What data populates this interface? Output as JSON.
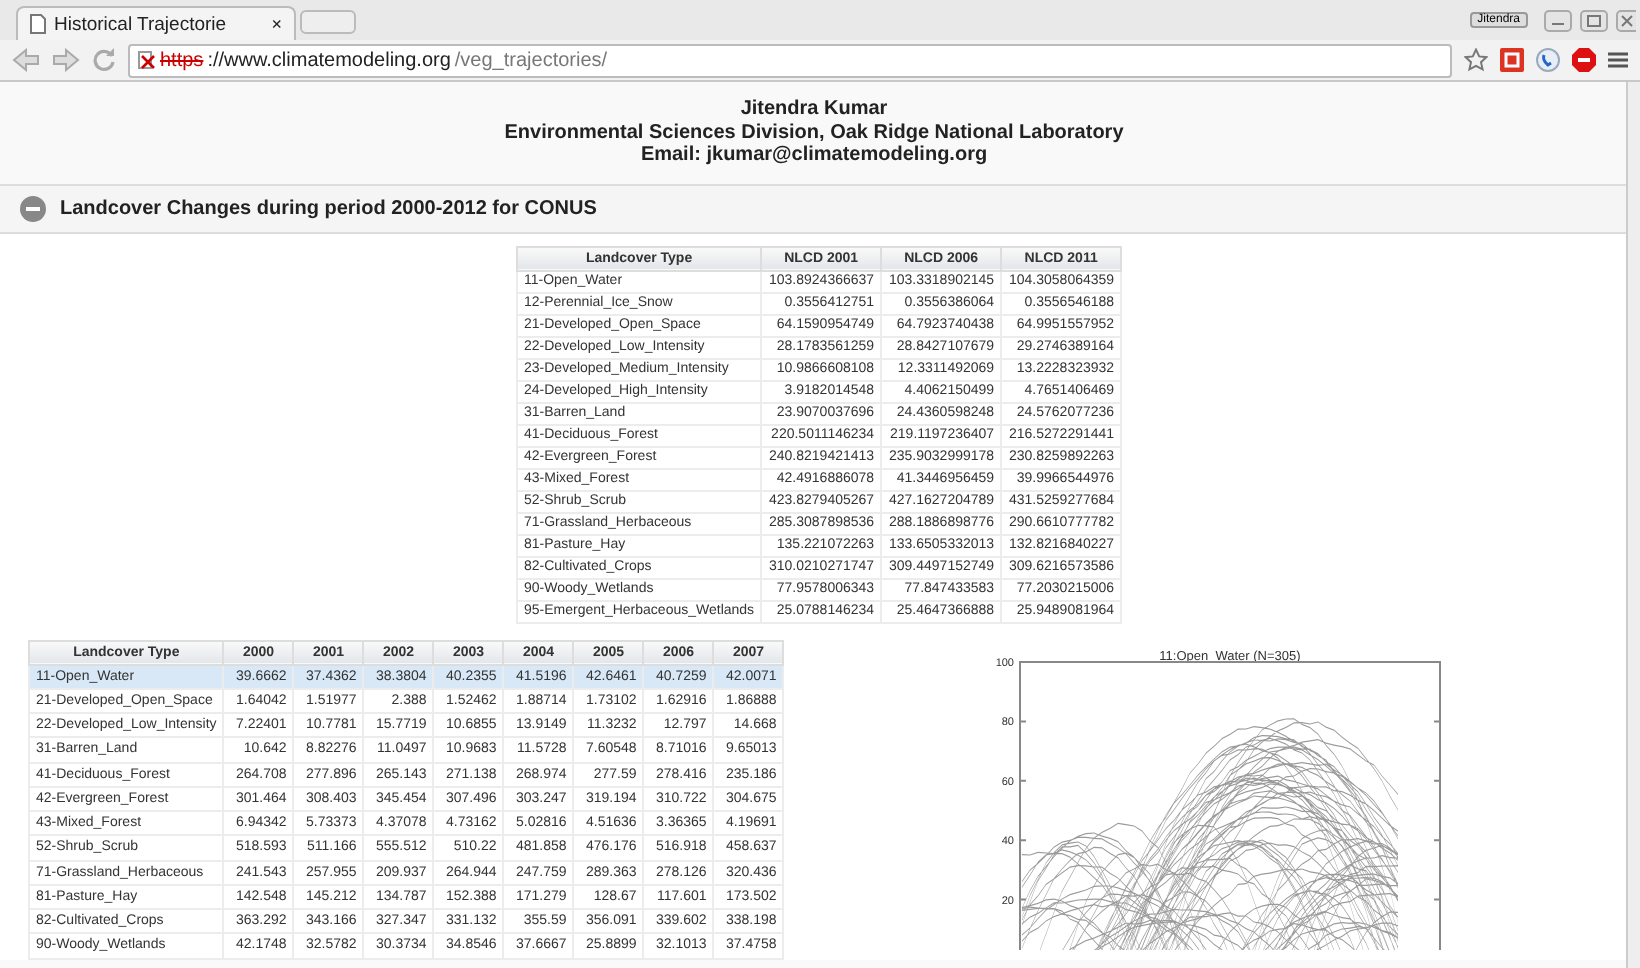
{
  "browser": {
    "tab_title": "Historical Trajectorie",
    "tab_close": "×",
    "profile": "Jitendra",
    "url_scheme": "https",
    "url_host": "://www.climatemodeling.org",
    "url_path": "/veg_trajectories/"
  },
  "author": {
    "name": "Jitendra Kumar",
    "affiliation": "Environmental Sciences Division, Oak Ridge National Laboratory",
    "email": "Email: jkumar@climatemodeling.org"
  },
  "section": {
    "title": "Landcover Changes during period 2000-2012 for CONUS",
    "expanded": true
  },
  "summary_table": {
    "columns": [
      "Landcover Type",
      "NLCD 2001",
      "NLCD 2006",
      "NLCD 2011"
    ],
    "rows": [
      [
        "11-Open_Water",
        "103.8924366637",
        "103.3318902145",
        "104.3058064359"
      ],
      [
        "12-Perennial_Ice_Snow",
        "0.3556412751",
        "0.3556386064",
        "0.3556546188"
      ],
      [
        "21-Developed_Open_Space",
        "64.1590954749",
        "64.7923740438",
        "64.9951557952"
      ],
      [
        "22-Developed_Low_Intensity",
        "28.1783561259",
        "28.8427107679",
        "29.2746389164"
      ],
      [
        "23-Developed_Medium_Intensity",
        "10.9866608108",
        "12.3311492069",
        "13.2228323932"
      ],
      [
        "24-Developed_High_Intensity",
        "3.9182014548",
        "4.4062150499",
        "4.7651406469"
      ],
      [
        "31-Barren_Land",
        "23.9070037696",
        "24.4360598248",
        "24.5762077236"
      ],
      [
        "41-Deciduous_Forest",
        "220.5011146234",
        "219.1197236407",
        "216.5272291441"
      ],
      [
        "42-Evergreen_Forest",
        "240.8219421413",
        "235.9032999178",
        "230.8259892263"
      ],
      [
        "43-Mixed_Forest",
        "42.4916886078",
        "41.3446956459",
        "39.9966544976"
      ],
      [
        "52-Shrub_Scrub",
        "423.8279405267",
        "427.1627204789",
        "431.5259277684"
      ],
      [
        "71-Grassland_Herbaceous",
        "285.3087898536",
        "288.1886898776",
        "290.6610777782"
      ],
      [
        "81-Pasture_Hay",
        "135.221072263",
        "133.6505332013",
        "132.8216840227"
      ],
      [
        "82-Cultivated_Crops",
        "310.0210271747",
        "309.4497152749",
        "309.6216573586"
      ],
      [
        "90-Woody_Wetlands",
        "77.9578006343",
        "77.847433583",
        "77.2030215006"
      ],
      [
        "95-Emergent_Herbaceous_Wetlands",
        "25.0788146234",
        "25.4647366888",
        "25.9489081964"
      ]
    ]
  },
  "yearly_table": {
    "columns": [
      "Landcover Type",
      "2000",
      "2001",
      "2002",
      "2003",
      "2004",
      "2005",
      "2006",
      "2007"
    ],
    "rows": [
      {
        "selected": true,
        "cells": [
          "11-Open_Water",
          "39.6662",
          "37.4362",
          "38.3804",
          "40.2355",
          "41.5196",
          "42.6461",
          "40.7259",
          "42.0071"
        ]
      },
      {
        "selected": false,
        "cells": [
          "21-Developed_Open_Space",
          "1.64042",
          "1.51977",
          "2.388",
          "1.52462",
          "1.88714",
          "1.73102",
          "1.62916",
          "1.86888"
        ]
      },
      {
        "selected": false,
        "cells": [
          "22-Developed_Low_Intensity",
          "7.22401",
          "10.7781",
          "15.7719",
          "10.6855",
          "13.9149",
          "11.3232",
          "12.797",
          "14.668"
        ]
      },
      {
        "selected": false,
        "cells": [
          "31-Barren_Land",
          "10.642",
          "8.82276",
          "11.0497",
          "10.9683",
          "11.5728",
          "7.60548",
          "8.71016",
          "9.65013"
        ]
      },
      {
        "selected": false,
        "cells": [
          "41-Deciduous_Forest",
          "264.708",
          "277.896",
          "265.143",
          "271.138",
          "268.974",
          "277.59",
          "278.416",
          "235.186"
        ]
      },
      {
        "selected": false,
        "cells": [
          "42-Evergreen_Forest",
          "301.464",
          "308.403",
          "345.454",
          "307.496",
          "303.247",
          "319.194",
          "310.722",
          "304.675"
        ]
      },
      {
        "selected": false,
        "cells": [
          "43-Mixed_Forest",
          "6.94342",
          "5.73373",
          "4.37078",
          "4.73162",
          "5.02816",
          "4.51636",
          "3.36365",
          "4.19691"
        ]
      },
      {
        "selected": false,
        "cells": [
          "52-Shrub_Scrub",
          "518.593",
          "511.166",
          "555.512",
          "510.22",
          "481.858",
          "476.176",
          "516.918",
          "458.637"
        ]
      },
      {
        "selected": false,
        "cells": [
          "71-Grassland_Herbaceous",
          "241.543",
          "257.955",
          "209.937",
          "264.944",
          "247.759",
          "289.363",
          "278.126",
          "320.436"
        ]
      },
      {
        "selected": false,
        "cells": [
          "81-Pasture_Hay",
          "142.548",
          "145.212",
          "134.787",
          "152.388",
          "171.279",
          "128.67",
          "117.601",
          "173.502"
        ]
      },
      {
        "selected": false,
        "cells": [
          "82-Cultivated_Crops",
          "363.292",
          "343.166",
          "327.347",
          "331.132",
          "355.59",
          "356.091",
          "339.602",
          "338.198"
        ]
      },
      {
        "selected": false,
        "cells": [
          "90-Woody_Wetlands",
          "42.1748",
          "32.5782",
          "30.3734",
          "34.8546",
          "37.6667",
          "25.8899",
          "32.1013",
          "37.4758"
        ]
      }
    ]
  },
  "trajectory_plot": {
    "title": "11:Open_Water (N=305)",
    "y_tick_labels": [
      "100",
      "80",
      "60",
      "40",
      "20"
    ]
  }
}
